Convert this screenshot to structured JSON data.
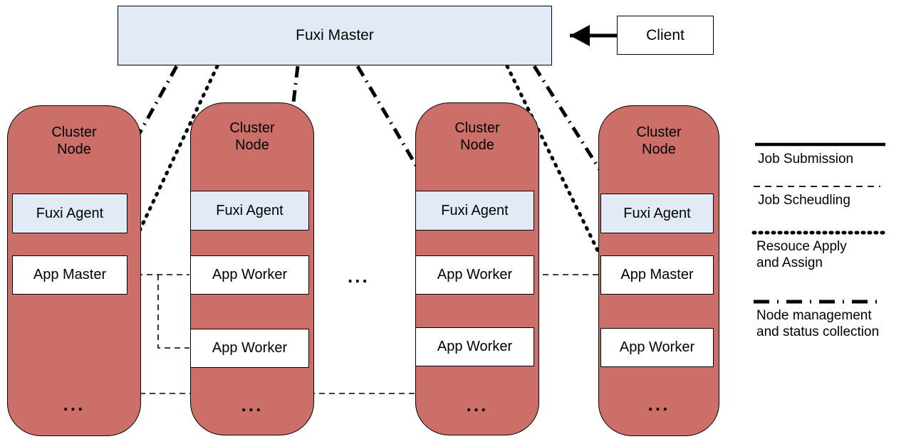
{
  "diagram": {
    "title_box": {
      "label": "Fuxi Master"
    },
    "client_box": {
      "label": "Client"
    },
    "gap_ellipsis": "...",
    "node_label_line1": "Cluster",
    "node_label_line2": "Node",
    "node_ellipsis": "...",
    "nodes": [
      {
        "id": "cluster-node-1",
        "title": "Cluster\nNode",
        "components": [
          {
            "type": "agent",
            "label": "Fuxi Agent"
          },
          {
            "type": "master",
            "label": "App Master"
          }
        ],
        "ellipsis": "..."
      },
      {
        "id": "cluster-node-2",
        "title": "Cluster\nNode",
        "components": [
          {
            "type": "agent",
            "label": "Fuxi Agent"
          },
          {
            "type": "worker",
            "label": "App Worker"
          },
          {
            "type": "worker",
            "label": "App Worker"
          }
        ],
        "ellipsis": "..."
      },
      {
        "id": "cluster-node-3",
        "title": "Cluster\nNode",
        "components": [
          {
            "type": "agent",
            "label": "Fuxi Agent"
          },
          {
            "type": "worker",
            "label": "App Worker"
          },
          {
            "type": "worker",
            "label": "App Worker"
          }
        ],
        "ellipsis": "..."
      },
      {
        "id": "cluster-node-4",
        "title": "Cluster\nNode",
        "components": [
          {
            "type": "agent",
            "label": "Fuxi Agent"
          },
          {
            "type": "master",
            "label": "App Master"
          },
          {
            "type": "worker",
            "label": "App Worker"
          }
        ],
        "ellipsis": "..."
      }
    ]
  },
  "legend": {
    "entries": [
      {
        "style": "solid",
        "label": "Job Submission"
      },
      {
        "style": "dashed",
        "label": "Job Scheudling"
      },
      {
        "style": "dotted",
        "label": "Resouce Apply\nand Assign"
      },
      {
        "style": "dashdot",
        "label": "Node management\nand status collection"
      }
    ]
  },
  "colors": {
    "node_fill": "#cb6f68",
    "master_fill": "#e2eaf6",
    "agent_fill": "#e2eaf6",
    "worker_fill": "#ffffff",
    "stroke": "#000000"
  }
}
